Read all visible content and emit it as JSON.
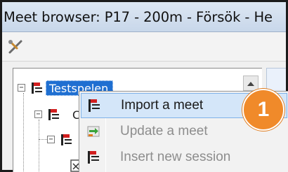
{
  "window": {
    "title": "Meet browser: P17 - 200m - Försök - He"
  },
  "toolbar": {
    "tools_icon": "tools-icon"
  },
  "tree": {
    "selected_node_label": "Testspelen",
    "child_node_label": "C",
    "expander_symbol": "−",
    "node_icon": "meet-flag-icon"
  },
  "context_menu": {
    "items": [
      {
        "label": "Import a meet",
        "icon": "import-flag-icon",
        "enabled": true,
        "highlighted": true
      },
      {
        "label": "Update a meet",
        "icon": "update-arrows-icon",
        "enabled": false,
        "highlighted": false
      },
      {
        "label": "Insert new session",
        "icon": "insert-flag-icon",
        "enabled": false,
        "highlighted": false
      }
    ]
  },
  "annotation": {
    "badge_number": "1",
    "badge_color": "#f08a2a"
  },
  "colors": {
    "selection": "#1f6fd1",
    "menu_hover": "#d4e6f9",
    "flag_red": "#d21f1f"
  }
}
